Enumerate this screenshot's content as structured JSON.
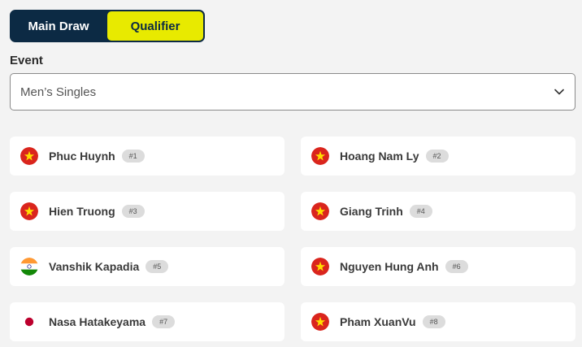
{
  "draw_toggle": {
    "main_draw_label": "Main Draw",
    "qualifier_label": "Qualifier",
    "active": "Qualifier"
  },
  "event": {
    "label": "Event",
    "selected": "Men’s Singles"
  },
  "colors": {
    "toggle_bg": "#0c2a44",
    "toggle_active": "#e8ea00",
    "page_bg": "#f3f3f3",
    "card_bg": "#ffffff",
    "seed_bg": "#dcdcdc"
  },
  "players": [
    {
      "name": "Phuc Huynh",
      "seed": "#1",
      "flag": "vietnam-flag-icon"
    },
    {
      "name": "Hoang Nam Ly",
      "seed": "#2",
      "flag": "vietnam-flag-icon"
    },
    {
      "name": "Hien Truong",
      "seed": "#3",
      "flag": "vietnam-flag-icon"
    },
    {
      "name": "Giang Trinh",
      "seed": "#4",
      "flag": "vietnam-flag-icon"
    },
    {
      "name": "Vanshik Kapadia",
      "seed": "#5",
      "flag": "india-flag-icon"
    },
    {
      "name": "Nguyen Hung Anh",
      "seed": "#6",
      "flag": "vietnam-flag-icon"
    },
    {
      "name": "Nasa Hatakeyama",
      "seed": "#7",
      "flag": "japan-flag-icon"
    },
    {
      "name": "Pham XuanVu",
      "seed": "#8",
      "flag": "vietnam-flag-icon"
    }
  ]
}
